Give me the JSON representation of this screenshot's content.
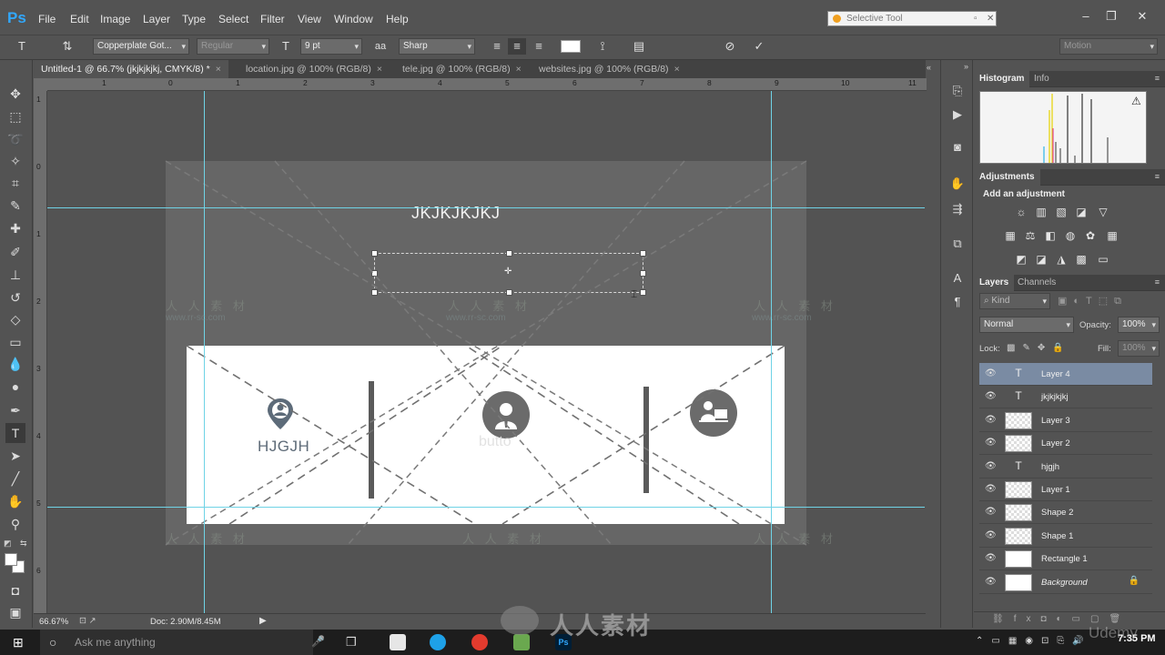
{
  "app": {
    "logo": "Ps",
    "menu": [
      "File",
      "Edit",
      "Image",
      "Layer",
      "Type",
      "Select",
      "Filter",
      "View",
      "Window",
      "Help"
    ],
    "search_text": "Selective Tool",
    "window_controls": [
      "minimize-icon",
      "restore-icon",
      "close-icon"
    ]
  },
  "options_bar": {
    "font_family": "Copperplate Got...",
    "font_style": "Regular",
    "font_size": "9 pt",
    "antialias_label": "a",
    "antialias": "Sharp",
    "text_color": "#ffffff",
    "workspace": "Motion"
  },
  "tabs": [
    "Untitled-1 @ 66.7% (jkjkjkjkj, CMYK/8) *",
    "location.jpg @ 100% (RGB/8)",
    "tele.jpg @ 100% (RGB/8)",
    "websites.jpg @ 100% (RGB/8)"
  ],
  "ruler": {
    "h": [
      "1",
      "0",
      "1",
      "2",
      "3",
      "4",
      "5",
      "6",
      "7",
      "8",
      "9",
      "10",
      "11"
    ],
    "v": [
      "1",
      "0",
      "1",
      "2",
      "3",
      "4",
      "5",
      "6"
    ]
  },
  "canvas": {
    "headline": "JKJKJKJKJ",
    "label_left": "HJGJH",
    "label_middle": "butto",
    "watermark_text": "人 人 素 材",
    "watermark_url": "www.rr-sc.com"
  },
  "status": {
    "zoom": "66.67%",
    "doc": "Doc: 2.90M/8.45M"
  },
  "panels": {
    "histogram_tab": "Histogram",
    "info_tab": "Info",
    "adjustments_tab": "Adjustments",
    "add_adjustment": "Add an adjustment",
    "layers_tab": "Layers",
    "channels_tab": "Channels",
    "filter_kind": "Kind",
    "blend_mode": "Normal",
    "opacity_label": "Opacity:",
    "opacity_value": "100%",
    "lock_label": "Lock:",
    "fill_label": "Fill:",
    "fill_value": "100%"
  },
  "layers": [
    {
      "name": "Layer 4",
      "thumb": "T",
      "selected": true
    },
    {
      "name": "jkjkjkjkj",
      "thumb": "T",
      "selected": false
    },
    {
      "name": "Layer 3",
      "thumb": "",
      "selected": false
    },
    {
      "name": "Layer 2",
      "thumb": "",
      "selected": false
    },
    {
      "name": "hjgjh",
      "thumb": "T",
      "selected": false
    },
    {
      "name": "Layer 1",
      "thumb": "",
      "selected": false
    },
    {
      "name": "Shape 2",
      "thumb": "",
      "selected": false
    },
    {
      "name": "Shape 1",
      "thumb": "",
      "selected": false
    },
    {
      "name": "Rectangle 1",
      "thumb": "",
      "selected": false
    },
    {
      "name": "Background",
      "thumb": "",
      "selected": false
    }
  ],
  "taskbar": {
    "search_placeholder": "Ask me anything",
    "time": "7:35 PM"
  },
  "overlay_brand": "人人素材",
  "overlay_corner": "Udemy"
}
